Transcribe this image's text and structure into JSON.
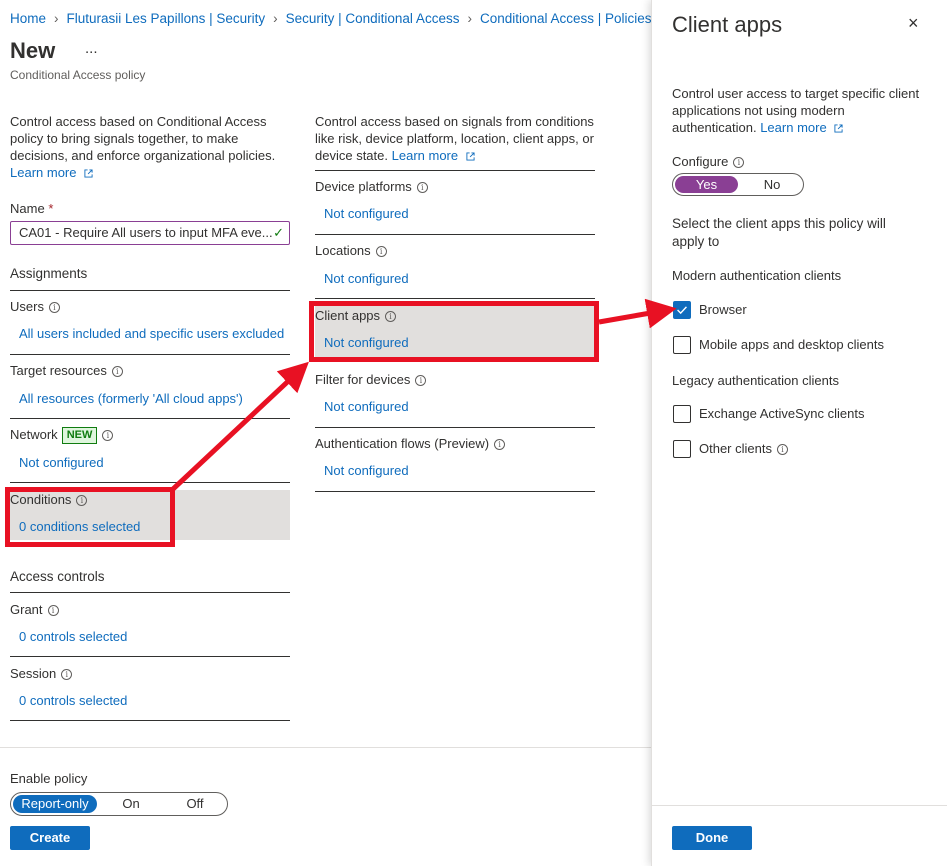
{
  "breadcrumb": {
    "items": [
      "Home",
      "Fluturasii Les Papillons | Security",
      "Security | Conditional Access",
      "Conditional Access | Policies"
    ]
  },
  "page": {
    "title": "New",
    "more": "...",
    "subtitle": "Conditional Access policy"
  },
  "left": {
    "intro": "Control access based on Conditional Access policy to bring signals together, to make decisions, and enforce organizational policies.",
    "learn_more": "Learn more",
    "name_label": "Name",
    "name_required": "*",
    "name_value": "CA01 - Require All users to input MFA eve...",
    "assignments_title": "Assignments",
    "users_label": "Users",
    "users_value": "All users included and specific users excluded",
    "target_label": "Target resources",
    "target_value": "All resources (formerly 'All cloud apps')",
    "network_label": "Network",
    "network_badge": "NEW",
    "network_value": "Not configured",
    "conditions_label": "Conditions",
    "conditions_value": "0 conditions selected",
    "access_title": "Access controls",
    "grant_label": "Grant",
    "grant_value": "0 controls selected",
    "session_label": "Session",
    "session_value": "0 controls selected"
  },
  "middle": {
    "intro": "Control access based on signals from conditions like risk, device platform, location, client apps, or device state.",
    "learn_more": "Learn more",
    "device_platforms_label": "Device platforms",
    "device_platforms_value": "Not configured",
    "locations_label": "Locations",
    "locations_value": "Not configured",
    "client_apps_label": "Client apps",
    "client_apps_value": "Not configured",
    "filter_label": "Filter for devices",
    "filter_value": "Not configured",
    "auth_flows_label": "Authentication flows (Preview)",
    "auth_flows_value": "Not configured"
  },
  "footer": {
    "enable_label": "Enable policy",
    "options": [
      "Report-only",
      "On",
      "Off"
    ],
    "create": "Create"
  },
  "panel": {
    "title": "Client apps",
    "close": "×",
    "intro": "Control user access to target specific client applications not using modern authentication.",
    "learn_more": "Learn more",
    "configure_label": "Configure",
    "yes": "Yes",
    "no": "No",
    "select_text": "Select the client apps this policy will apply to",
    "modern_title": "Modern authentication clients",
    "browser": "Browser",
    "mobile": "Mobile apps and desktop clients",
    "legacy_title": "Legacy authentication clients",
    "exchange": "Exchange ActiveSync clients",
    "other": "Other clients",
    "done": "Done"
  },
  "colors": {
    "link": "#0f6cbd",
    "accent_purple": "#8a3f94",
    "annotation_red": "#e81123",
    "highlight": "#e1dfdd"
  },
  "states": {
    "configure": "Yes",
    "enable_policy": "Report-only",
    "browser_checked": true,
    "mobile_checked": false,
    "exchange_checked": false,
    "other_checked": false
  }
}
